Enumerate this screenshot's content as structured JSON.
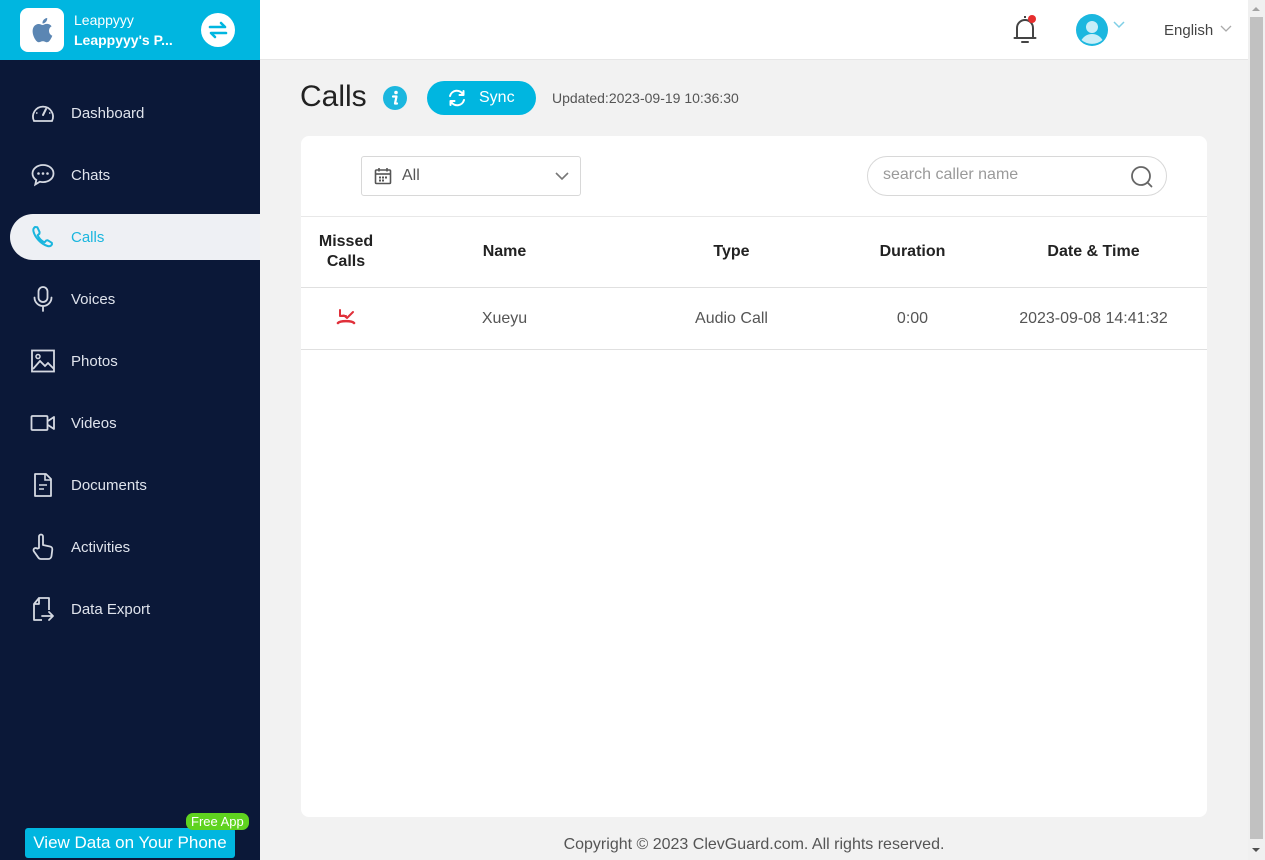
{
  "brand": {
    "name": "Leappyyy",
    "device": "Leappyyy's P...",
    "logo_icon": "apple-icon",
    "switch_icon": "switch-device-icon"
  },
  "sidebar": {
    "items": [
      {
        "label": "Dashboard",
        "icon": "dashboard-icon",
        "active": false
      },
      {
        "label": "Chats",
        "icon": "chat-icon",
        "active": false
      },
      {
        "label": "Calls",
        "icon": "phone-icon",
        "active": true
      },
      {
        "label": "Voices",
        "icon": "microphone-icon",
        "active": false
      },
      {
        "label": "Photos",
        "icon": "photo-icon",
        "active": false
      },
      {
        "label": "Videos",
        "icon": "video-icon",
        "active": false
      },
      {
        "label": "Documents",
        "icon": "document-icon",
        "active": false
      },
      {
        "label": "Activities",
        "icon": "hand-pointer-icon",
        "active": false
      },
      {
        "label": "Data Export",
        "icon": "export-icon",
        "active": false
      }
    ],
    "phone_button": "View Data on Your Phone",
    "free_badge": "Free App"
  },
  "header": {
    "language": "English",
    "has_notification": true
  },
  "page": {
    "title": "Calls",
    "sync_label": "Sync",
    "updated": "Updated:2023-09-19 10:36:30"
  },
  "filters": {
    "date_filter": "All",
    "search_placeholder": "search caller name",
    "search_value": ""
  },
  "table": {
    "columns": [
      "Missed Calls",
      "Name",
      "Type",
      "Duration",
      "Date & Time"
    ],
    "rows": [
      {
        "missed": true,
        "name": "Xueyu",
        "type": "Audio Call",
        "duration": "0:00",
        "datetime": "2023-09-08 14:41:32"
      }
    ]
  },
  "colors": {
    "accent": "#00b6e0",
    "sidebar_bg": "#0b1838",
    "missed_red": "#e0303a",
    "badge_green": "#5fd31f"
  },
  "footer": {
    "copyright": "Copyright © 2023 ClevGuard.com. All rights reserved."
  }
}
